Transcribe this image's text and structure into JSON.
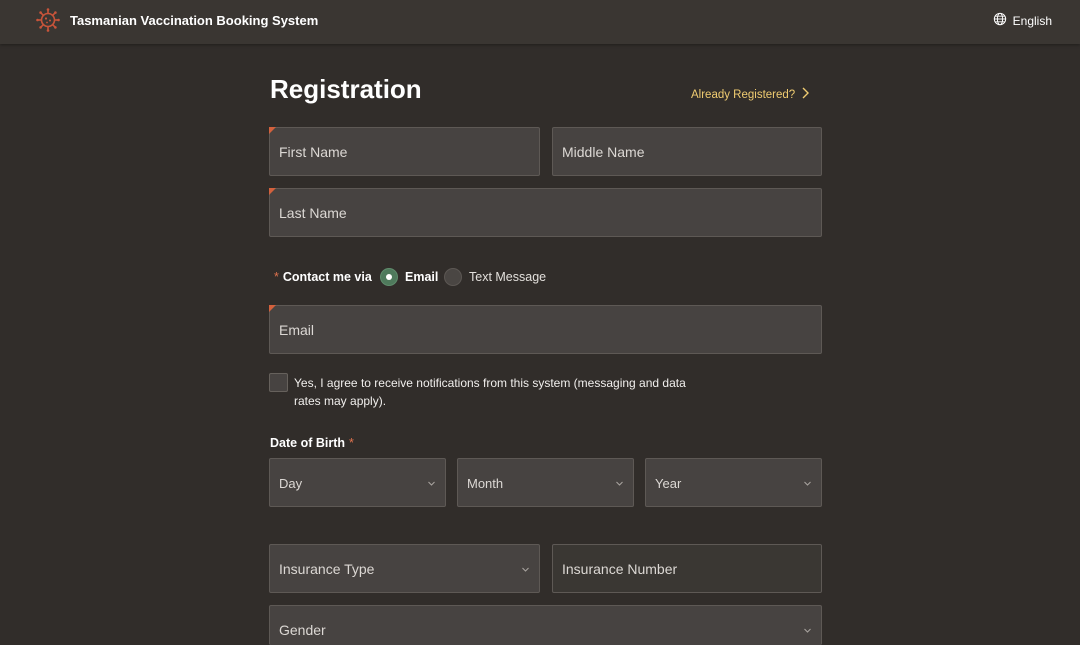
{
  "header": {
    "app_title": "Tasmanian Vaccination Booking System",
    "language": "English",
    "logo_icon": "virus-icon",
    "globe_icon": "globe-icon"
  },
  "form": {
    "title": "Registration",
    "already_registered": "Already Registered?",
    "first_name": {
      "placeholder": "First Name",
      "value": ""
    },
    "middle_name": {
      "placeholder": "Middle Name",
      "value": ""
    },
    "last_name": {
      "placeholder": "Last Name",
      "value": ""
    },
    "contact": {
      "label": "Contact me via",
      "required_mark": "*",
      "options": [
        "Email",
        "Text Message"
      ],
      "selected": "Email"
    },
    "email": {
      "placeholder": "Email",
      "value": ""
    },
    "consent": {
      "label": "Yes, I agree to receive notifications from this system (messaging and data rates may apply).",
      "checked": false
    },
    "dob": {
      "label": "Date of Birth",
      "required_mark": "*",
      "day": "Day",
      "month": "Month",
      "year": "Year"
    },
    "insurance_type": "Insurance Type",
    "insurance_number": "Insurance Number",
    "gender": "Gender"
  },
  "colors": {
    "background": "#312d2a",
    "header": "#3a3632",
    "field": "#474341",
    "accent_link": "#f0cc71",
    "required": "#d3613d",
    "radio_selected": "#4f7a5c"
  }
}
